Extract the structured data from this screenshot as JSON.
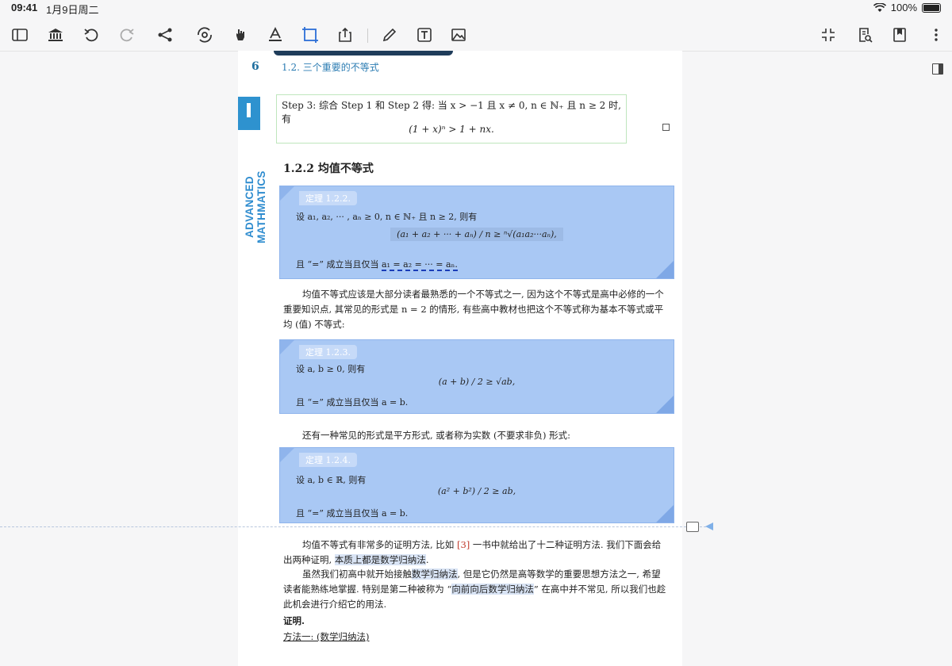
{
  "status_bar": {
    "time": "09:41",
    "date": "1月9日周二",
    "battery": "100%"
  },
  "toolbar": {
    "left_icons": [
      "sidebar-icon",
      "library-icon",
      "undo-icon",
      "redo-icon",
      "share-graph-icon",
      "settings-sync-icon",
      "hand-icon",
      "text-color-icon",
      "crop-select-icon",
      "export-icon"
    ],
    "right_icons": [
      "pen-icon",
      "text-box-icon",
      "image-icon"
    ],
    "far_right_icons": [
      "compress-icon",
      "search-document-icon",
      "bookmark-icon",
      "more-icon"
    ],
    "active": "crop-select-icon",
    "accent": "#2c6fd6"
  },
  "page": {
    "number": "6",
    "running_head": "1.2.  三个重要的不等式",
    "side_banner": "ADVANCED MATHMATICS",
    "step3": {
      "line1": "Step 3: 综合 Step 1 和 Step 2 得: 当 x > −1 且 x ≠ 0, n ∈ ℕ₊ 且 n ≥ 2 时, 有",
      "formula": "(1 + x)ⁿ > 1 + nx."
    },
    "section_title": "1.2.2    均值不等式",
    "theorem1": {
      "label": "定理 1.2.2.",
      "line1": "设 a₁, a₂, ··· , aₙ ≥ 0, n ∈ ℕ₊ 且 n ≥ 2, 则有",
      "formula": "(a₁ + a₂ + ··· + aₙ) / n  ≥  ⁿ√(a₁a₂···aₙ),",
      "equality_prefix": "且 “=” 成立当且仅当 ",
      "equality_cond": "a₁ = a₂ = ··· = aₙ."
    },
    "para1": "均值不等式应该是大部分读者最熟悉的一个不等式之一, 因为这个不等式是高中必修的一个重要知识点, 其常见的形式是 n = 2 的情形, 有些高中教材也把这个不等式称为基本不等式或平均 (值) 不等式:",
    "theorem2": {
      "label": "定理 1.2.3.",
      "line1": "设 a, b ≥ 0, 则有",
      "formula": "(a + b) / 2 ≥ √ab,",
      "equality": "且 “=” 成立当且仅当 a = b."
    },
    "para2": "还有一种常见的形式是平方形式, 或者称为实数 (不要求非负) 形式:",
    "theorem3": {
      "label": "定理 1.2.4.",
      "line1": "设 a, b ∈ ℝ, 则有",
      "formula": "(a² + b²) / 2 ≥ ab,",
      "equality": "且 “=” 成立当且仅当 a = b."
    },
    "para3_a": "均值不等式有非常多的证明方法, 比如 ",
    "para3_ref": "[3]",
    "para3_b": " 一书中就给出了十二种证明方法. 我们下面会给出两种证明, ",
    "para3_hl": "本质上都是数学归纳法",
    "para3_c": ".",
    "para4_a": "虽然我们初高中就开始接触",
    "para4_hl1": "数学归纳法",
    "para4_b": ", 但是它仍然是高等数学的重要思想方法之一, 希望读者能熟练地掌握. 特别是第二种被称为 “",
    "para4_hl2": "向前向后数学归纳法",
    "para4_c": "” 在高中并不常见, 所以我们也趁此机会进行介绍它的用法.",
    "proof_label": "证明.",
    "method1": "方法一: (数学归纳法)"
  }
}
